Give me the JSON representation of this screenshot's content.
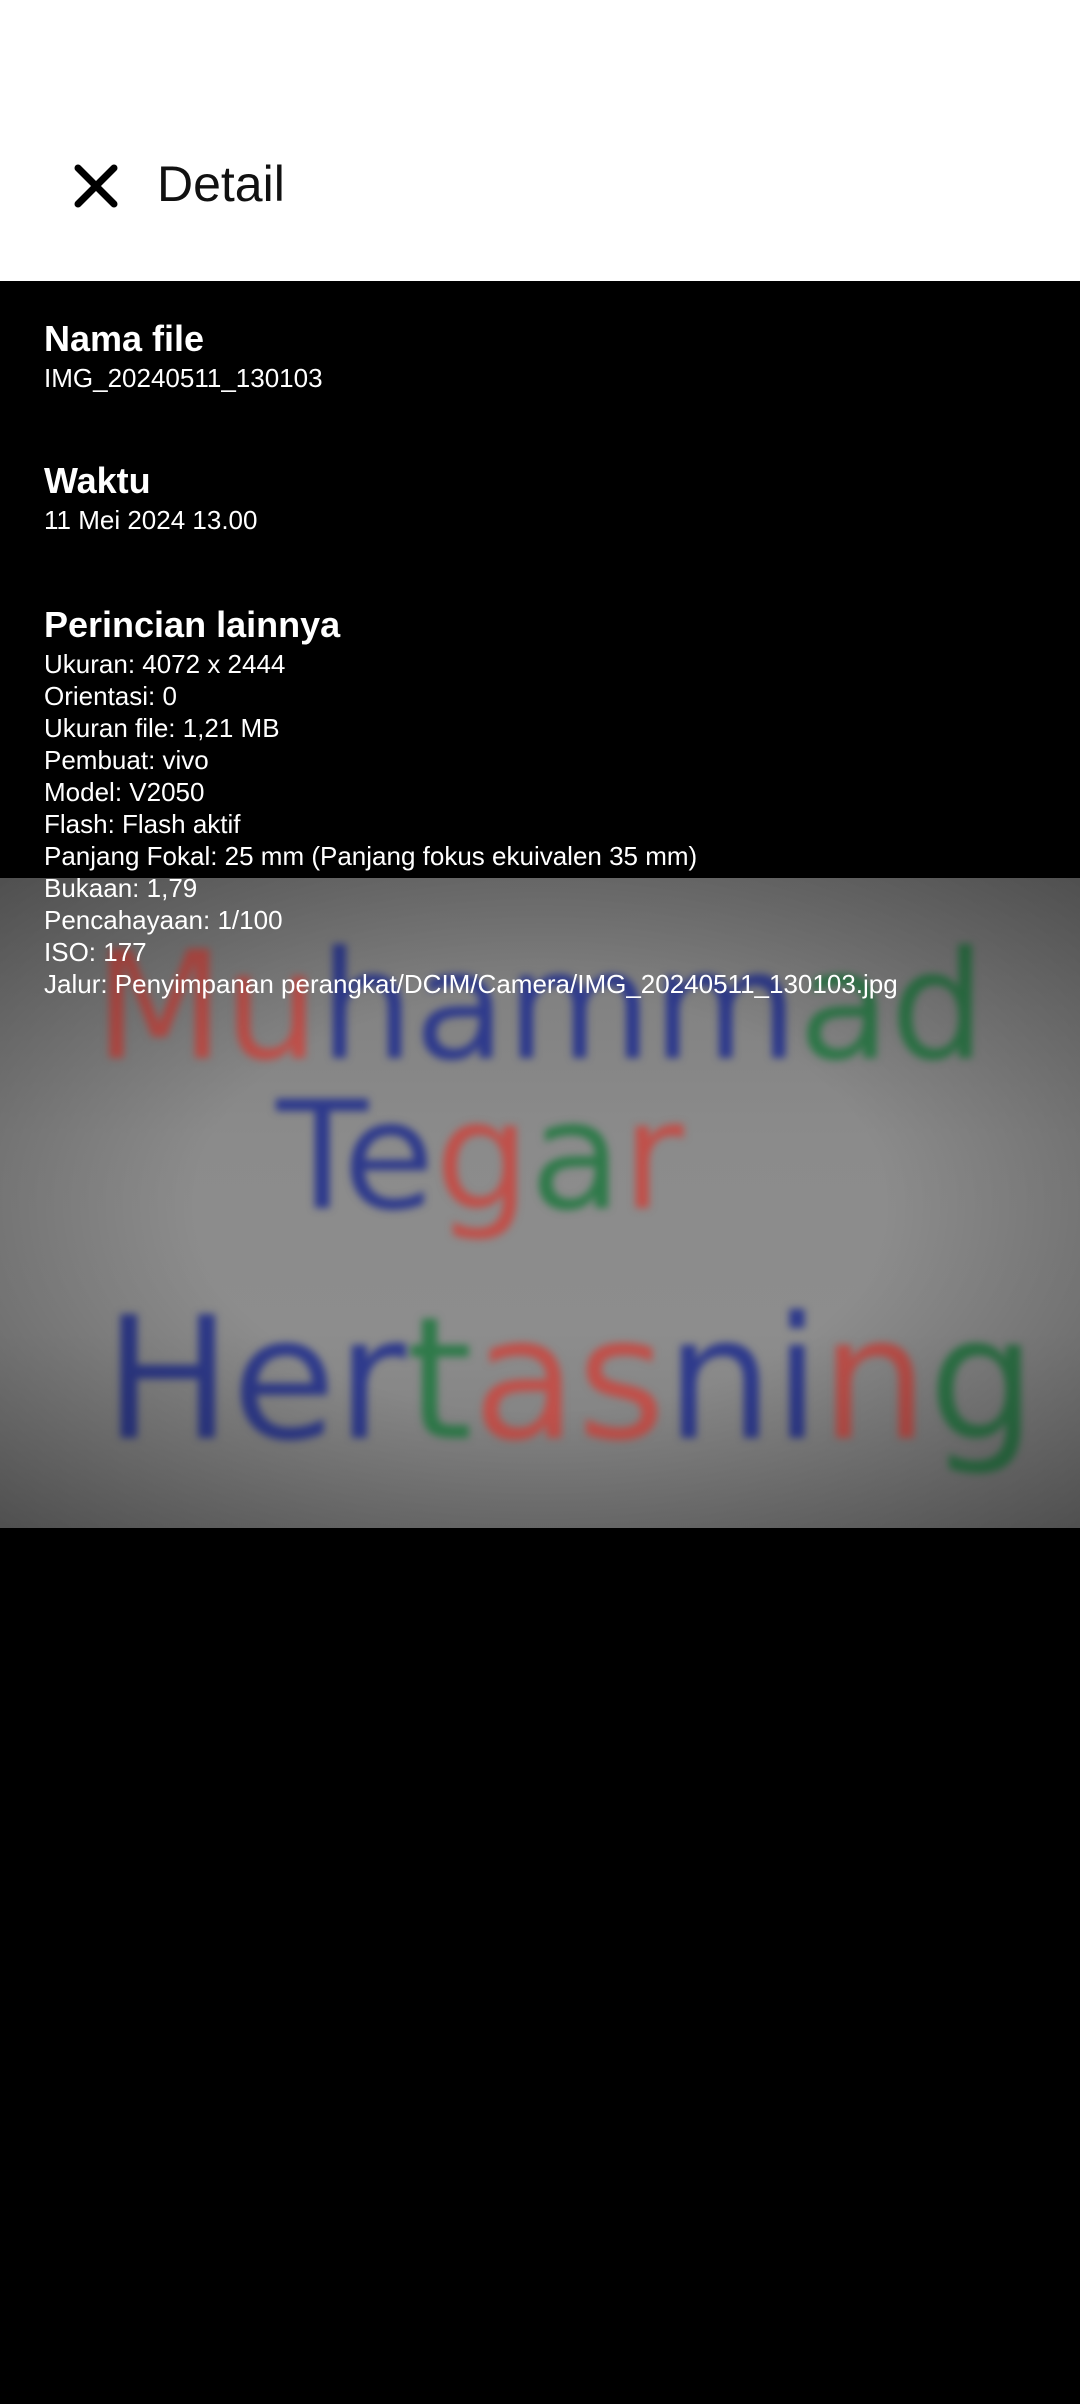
{
  "header": {
    "title": "Detail",
    "close_icon": "close-icon"
  },
  "file_name": {
    "label": "Nama file",
    "value": "IMG_20240511_130103"
  },
  "time": {
    "label": "Waktu",
    "value": "11 Mei 2024 13.00"
  },
  "other_details": {
    "label": "Perincian lainnya",
    "items": [
      "Ukuran: 4072 x 2444",
      "Orientasi: 0",
      "Ukuran file: 1,21 MB",
      "Pembuat: vivo",
      "Model: V2050",
      "Flash: Flash aktif",
      "Panjang Fokal: 25 mm (Panjang fokus ekuivalen 35 mm)",
      "Bukaan: 1,79",
      "Pencahayaan: 1/100",
      "ISO: 177",
      "Jalur: Penyimpanan perangkat/DCIM/Camera/IMG_20240511_130103.jpg"
    ]
  },
  "photo": {
    "lines": [
      {
        "letters": [
          {
            "ch": "M",
            "color": "#c0504a"
          },
          {
            "ch": "u",
            "color": "#c0504a"
          },
          {
            "ch": "h",
            "color": "#2e3a8c"
          },
          {
            "ch": "a",
            "color": "#2e3a8c"
          },
          {
            "ch": "m",
            "color": "#2e3a8c"
          },
          {
            "ch": "m",
            "color": "#2e3a8c"
          },
          {
            "ch": "a",
            "color": "#2f7a4a"
          },
          {
            "ch": "d",
            "color": "#2f7a4a"
          }
        ]
      },
      {
        "letters": [
          {
            "ch": "T",
            "color": "#2e3a8c"
          },
          {
            "ch": "e",
            "color": "#2e3a8c"
          },
          {
            "ch": "g",
            "color": "#c0504a"
          },
          {
            "ch": "a",
            "color": "#2f7a4a"
          },
          {
            "ch": "r",
            "color": "#c0504a"
          }
        ]
      },
      {
        "letters": [
          {
            "ch": "H",
            "color": "#2e3a8c"
          },
          {
            "ch": "e",
            "color": "#2e3a8c"
          },
          {
            "ch": "r",
            "color": "#2e3a8c"
          },
          {
            "ch": "t",
            "color": "#2f7a4a"
          },
          {
            "ch": "a",
            "color": "#c0504a"
          },
          {
            "ch": "s",
            "color": "#c0504a"
          },
          {
            "ch": "n",
            "color": "#2e3a8c"
          },
          {
            "ch": "i",
            "color": "#2e3a8c"
          },
          {
            "ch": "n",
            "color": "#c0504a"
          },
          {
            "ch": "g",
            "color": "#2f7a4a"
          }
        ]
      }
    ]
  }
}
